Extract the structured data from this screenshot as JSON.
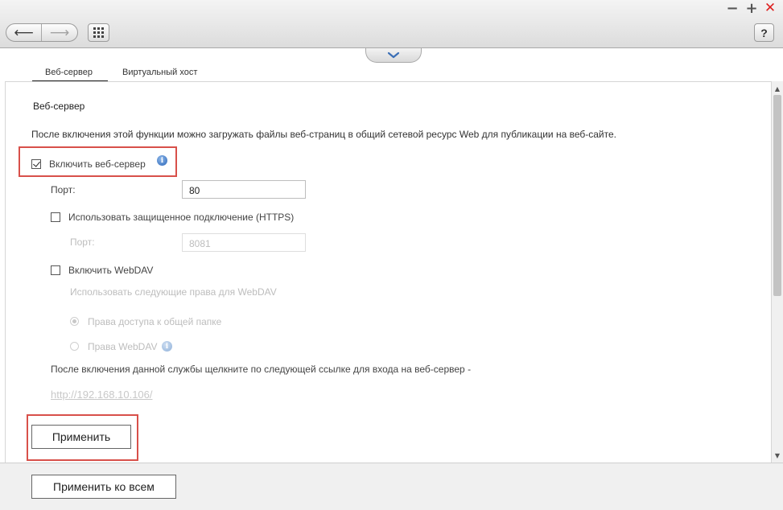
{
  "window_controls": {
    "minimize": "−",
    "maximize": "+",
    "close": "✕"
  },
  "toolbar": {
    "back_icon": "arrow-left-icon",
    "back": "⟵",
    "forward_icon": "arrow-right-icon",
    "forward": "⟶",
    "apps_icon": "grid-icon",
    "help": "?"
  },
  "tabs": [
    {
      "label": "Веб-сервер",
      "active": true
    },
    {
      "label": "Виртуальный хост",
      "active": false
    }
  ],
  "web_server": {
    "title": "Веб-сервер",
    "description": "После включения этой функции можно загружать файлы веб-страниц в общий сетевой ресурс Web для публикации на веб-сайте.",
    "enable_label": "Включить веб-сервер",
    "enable_checked": true,
    "port_label": "Порт:",
    "port_value": "80",
    "https_label": "Использовать защищенное подключение (HTTPS)",
    "https_checked": false,
    "https_port_label": "Порт:",
    "https_port_value": "8081",
    "webdav_label": "Включить WebDAV",
    "webdav_checked": false,
    "webdav_rights_label": "Использовать следующие права для WebDAV",
    "rights_options": [
      {
        "label": "Права доступа к общей папке",
        "selected": true
      },
      {
        "label": "Права WebDAV",
        "selected": false
      }
    ],
    "link_hint": "После включения данной службы щелкните по следующей ссылке для входа на веб-сервер -",
    "link": "http://192.168.10.106/",
    "info_icon_text": "i"
  },
  "buttons": {
    "apply": "Применить",
    "apply_all": "Применить ко всем"
  },
  "scrollbar": {
    "up": "▲",
    "down": "▼"
  },
  "colors": {
    "highlight": "#d8504a",
    "close": "#dd2222"
  }
}
